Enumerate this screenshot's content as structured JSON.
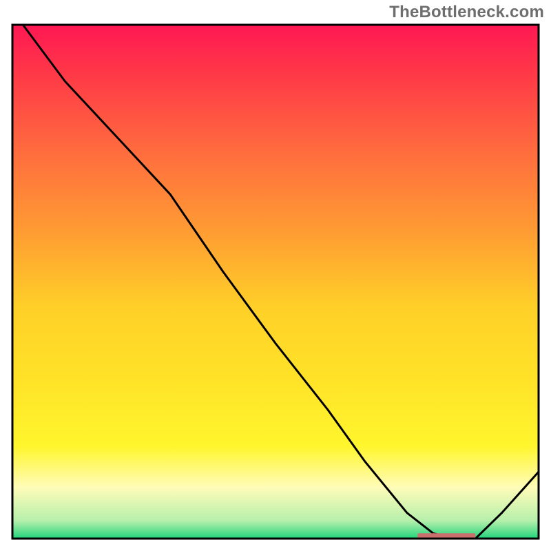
{
  "watermark": "TheBottleneck.com",
  "chart_data": {
    "type": "line",
    "xlim": [
      0,
      100
    ],
    "ylim": [
      0,
      100
    ],
    "xlabel": "",
    "ylabel": "",
    "title": "",
    "grid": false,
    "series": [
      {
        "name": "bottleneck-curve",
        "color": "#000000",
        "x": [
          2,
          10,
          20,
          30,
          40,
          50,
          60,
          67,
          75,
          80,
          84,
          88,
          93,
          100
        ],
        "y": [
          100,
          89,
          78,
          67,
          52,
          38,
          25,
          15,
          5,
          1,
          0,
          0,
          5,
          13
        ]
      }
    ],
    "marker": {
      "name": "optimal-segment",
      "color": "#c96f6d",
      "x_start": 77,
      "x_end": 88,
      "y": 0.5
    },
    "background_gradient": {
      "stops": [
        {
          "offset": 0.0,
          "color": "#ff1753"
        },
        {
          "offset": 0.1,
          "color": "#ff3a47"
        },
        {
          "offset": 0.25,
          "color": "#ff6d3e"
        },
        {
          "offset": 0.4,
          "color": "#ff9b33"
        },
        {
          "offset": 0.55,
          "color": "#ffd028"
        },
        {
          "offset": 0.7,
          "color": "#ffe428"
        },
        {
          "offset": 0.82,
          "color": "#fff62d"
        },
        {
          "offset": 0.9,
          "color": "#fffcb8"
        },
        {
          "offset": 0.965,
          "color": "#b6f0ac"
        },
        {
          "offset": 1.0,
          "color": "#21d37b"
        }
      ]
    },
    "border_color": "#000000"
  }
}
